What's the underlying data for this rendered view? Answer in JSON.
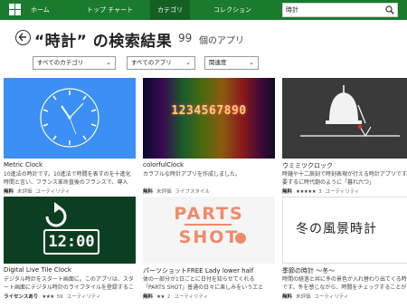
{
  "nav": {
    "items": [
      {
        "label": "ホーム"
      },
      {
        "label": "トップ チャート"
      },
      {
        "label": "カテゴリ"
      },
      {
        "label": "コレクション"
      }
    ]
  },
  "search": {
    "value": "時計"
  },
  "header": {
    "title": "“時計” の検索結果",
    "count": "99",
    "count_label": "個のアプリ"
  },
  "filters": [
    {
      "label": "すべてのカテゴリ"
    },
    {
      "label": "すべてのアプリ"
    },
    {
      "label": "関連度"
    }
  ],
  "tiles": [
    {
      "name": "Metric Clock",
      "desc": "10進法の時計です。10進法で時間を表すのを十進化時間と言い、フランス革命直後のフランスで、導入",
      "price": "無料",
      "rating": "未評価",
      "count": "",
      "category": "ユーティリティ"
    },
    {
      "name": "colorfulClock",
      "desc": "カラフルな時計アプリを作成しました。",
      "price": "無料",
      "rating": "未評価",
      "count": "",
      "category": "ライフスタイル",
      "thumb_text": "1234567890"
    },
    {
      "name": "ウミミツクロック",
      "desc": "時鐘や十二辰刻で時刻表現が行える時計アプリです。要するに時代劇のように「暮れ六つ」",
      "price": "無料",
      "rating": "★★★★★",
      "count": "3",
      "category": "ユーティリティ"
    },
    {
      "name": "Digital Live Tile Clock",
      "desc": "デジタル時計をスタート画面に。このアプリは、スタート画面にデジタル時計のライブタイルを登録することが",
      "price": "ライセンスあり",
      "rating": "★★★",
      "count": "59",
      "category": "ユーティリティ",
      "thumb_text": "12:00"
    },
    {
      "name": "パーツショットFREE Lady lower half",
      "desc": "体の一部分が1日ごとに日付を知らせてくれる「PARTS SHOT」普通の日々に楽しみをいうエと",
      "price": "無料",
      "rating": "★★",
      "count": "2",
      "category": "ユーティリティ",
      "thumb_line1": "PARTS",
      "thumb_line2": "SHOT"
    },
    {
      "name": "季節の時計 〜冬〜",
      "desc": "時間の経過と共に冬の景色が入れ替わり出てくる時計です。冬を感じながら、時間をチェックすることが",
      "price": "無料",
      "rating": "未評価",
      "count": "",
      "category": "ユーティリティ",
      "thumb_text": "冬の風景時計"
    }
  ],
  "colors": {
    "nav_bg": "#1a7a2e",
    "tile_blue": "#3b8ff5",
    "tile_green": "#0c3f22"
  }
}
